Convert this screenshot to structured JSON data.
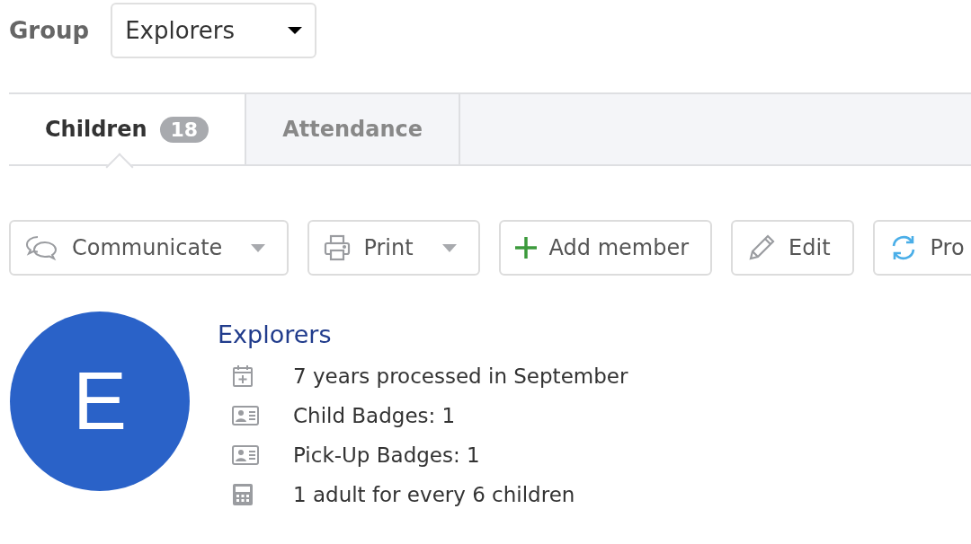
{
  "group_picker": {
    "label": "Group",
    "value": "Explorers"
  },
  "tabs": [
    {
      "label": "Children",
      "count": "18",
      "selected": true
    },
    {
      "label": "Attendance",
      "selected": false
    }
  ],
  "toolbar": [
    {
      "label": "Communicate",
      "kind": "chat",
      "menu": true
    },
    {
      "label": "Print",
      "kind": "print",
      "menu": true
    },
    {
      "label": "Add member",
      "kind": "plus",
      "menu": false
    },
    {
      "label": "Edit",
      "kind": "pencil",
      "menu": false
    },
    {
      "label": "Pro",
      "kind": "sync"
    }
  ],
  "group": {
    "initial": "E",
    "name": "Explorers",
    "details": [
      {
        "kind": "calendar",
        "text": "7 years processed in September"
      },
      {
        "kind": "badge",
        "text": "Child Badges: 1"
      },
      {
        "kind": "badge",
        "text": "Pick-Up Badges: 1"
      },
      {
        "kind": "calculator",
        "text": "1 adult for every 6 children"
      }
    ]
  }
}
